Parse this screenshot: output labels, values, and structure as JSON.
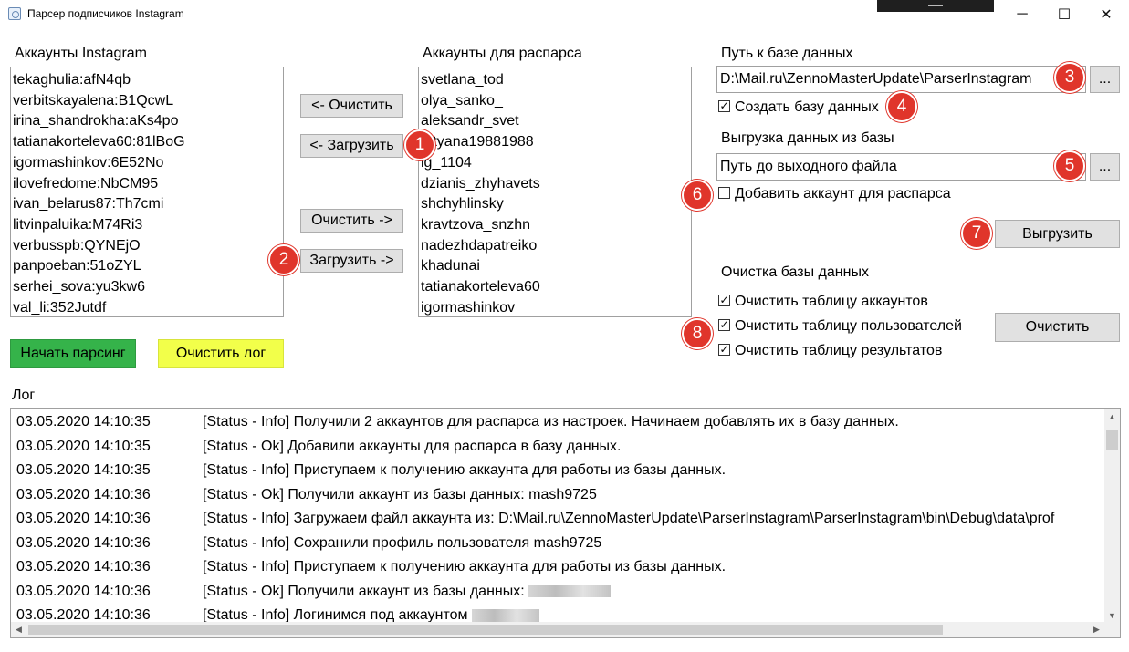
{
  "window": {
    "title": "Парсер подписчиков Instagram",
    "minimize_icon": "minimize-icon",
    "maximize_icon": "maximize-icon",
    "close_icon": "close-icon",
    "min_glyph": "─",
    "max_glyph": "☐",
    "close_glyph": "✕"
  },
  "accounts": {
    "label": "Аккаунты Instagram",
    "items": [
      "tekaghulia:afN4qb",
      "verbitskayalena:B1QcwL",
      "irina_shandrokha:aKs4po",
      "tatianakorteleva60:81lBoG",
      "igormashinkov:6E52No",
      "ilovefredome:NbCM95",
      "ivan_belarus87:Th7cmi",
      "litvinpaluika:M74Ri3",
      "verbusspb:QYNEjO",
      "panpoeban:51oZYL",
      "serhei_sova:yu3kw6",
      "val_li:352Jutdf"
    ]
  },
  "middle_buttons": {
    "clear_left": "<- Очистить",
    "load_left": "<- Загрузить",
    "clear_right": "Очистить ->",
    "load_right": "Загрузить ->"
  },
  "parse_accounts": {
    "label": "Аккаунты для распарса",
    "items": [
      "svetlana_tod",
      "olya_sanko_",
      "aleksandr_svet",
      "tatyana19881988",
      "ig_1104",
      "dzianis_zhyhavets",
      "shchyhlinsky",
      "kravtzova_snzhn",
      "nadezhdapatreiko",
      "khadunai",
      "tatianakorteleva60",
      "igormashinkov"
    ]
  },
  "database": {
    "path_label": "Путь к базе данных",
    "path_value": "D:\\Mail.ru\\ZennoMasterUpdate\\ParserInstagram",
    "browse": "...",
    "create_db_label": "Создать базу данных",
    "create_db_checked": true
  },
  "export": {
    "label": "Выгрузка данных из базы",
    "output_value": "Путь до выходного файла",
    "browse": "...",
    "add_account_label": "Добавить аккаунт для распарса",
    "add_account_checked": false,
    "export_button": "Выгрузить"
  },
  "cleanup": {
    "label": "Очистка базы данных",
    "accounts_table": "Очистить таблицу аккаунтов",
    "users_table": "Очистить таблицу пользователей",
    "results_table": "Очистить таблицу результатов",
    "clear_button": "Очистить",
    "check_glyph": "✓"
  },
  "actions": {
    "start": "Начать парсинг",
    "clear_log": "Очистить лог",
    "start_color": "#35b34a",
    "clear_log_color": "#f2ff4a"
  },
  "badges": [
    "1",
    "2",
    "3",
    "4",
    "5",
    "6",
    "7",
    "8"
  ],
  "log": {
    "label": "Лог",
    "rows": [
      {
        "ts": "03.05.2020 14:10:35",
        "msg": "[Status - Info] Получили 2 аккаунтов для распарса из настроек. Начинаем добавлять их в базу данных."
      },
      {
        "ts": "03.05.2020 14:10:35",
        "msg": "[Status - Ok] Добавили аккаунты для распарса в базу данных."
      },
      {
        "ts": "03.05.2020 14:10:35",
        "msg": "[Status - Info] Приступаем к получению аккаунта для работы из базы данных."
      },
      {
        "ts": "03.05.2020 14:10:36",
        "msg": "[Status - Ok] Получили аккаунт из базы данных: mash9725"
      },
      {
        "ts": "03.05.2020 14:10:36",
        "msg": "[Status - Info] Загружаем файл аккаунта из: D:\\Mail.ru\\ZennoMasterUpdate\\ParserInstagram\\ParserInstagram\\bin\\Debug\\data\\prof"
      },
      {
        "ts": "03.05.2020 14:10:36",
        "msg": "[Status - Info] Сохранили профиль пользователя mash9725"
      },
      {
        "ts": "03.05.2020 14:10:36",
        "msg": "[Status - Info] Приступаем к получению аккаунта для работы из базы данных."
      },
      {
        "ts": "03.05.2020 14:10:36",
        "msg": "[Status - Ok] Получили аккаунт из базы данных:"
      },
      {
        "ts": "03.05.2020 14:10:36",
        "msg": "[Status - Info] Логинимся под аккаунтом"
      }
    ],
    "scroll_up": "▲",
    "scroll_down": "▼",
    "scroll_left": "◀",
    "scroll_right": "▶"
  }
}
